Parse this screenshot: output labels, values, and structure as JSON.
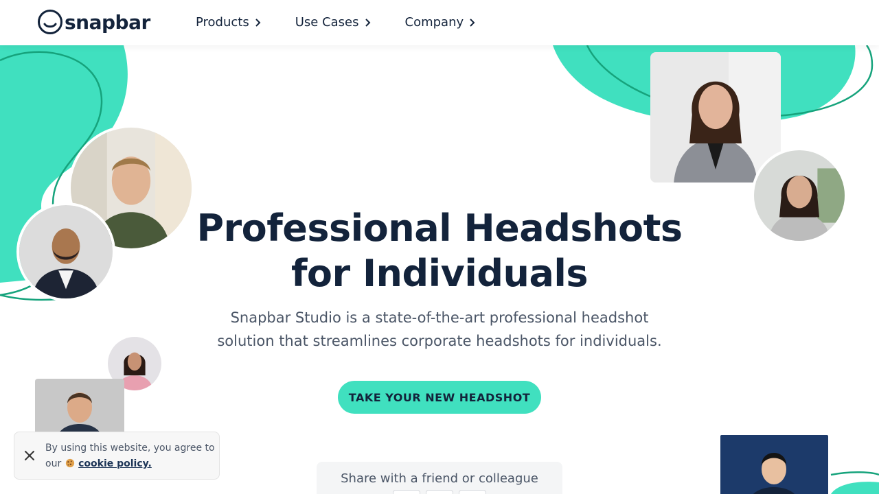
{
  "brand": {
    "name": "snapbar",
    "accent": "#40e0bf",
    "navy": "#13233b"
  },
  "nav": {
    "items": [
      {
        "label": "Products"
      },
      {
        "label": "Use Cases"
      },
      {
        "label": "Company"
      }
    ]
  },
  "hero": {
    "title_line1": "Professional Headshots",
    "title_line2": "for Individuals",
    "description_line1": "Snapbar Studio is a state-of-the-art professional headshot",
    "description_line2": "solution that streamlines corporate headshots for individuals.",
    "cta_label": "TAKE YOUR NEW HEADSHOT"
  },
  "share": {
    "text": "Share with a friend or colleague"
  },
  "cookie": {
    "text_before": "By using this website, you agree to our",
    "link_text": "cookie policy."
  },
  "icons": [
    "logo-mark-icon",
    "chevron-right-icon",
    "close-icon",
    "cookie-icon"
  ]
}
